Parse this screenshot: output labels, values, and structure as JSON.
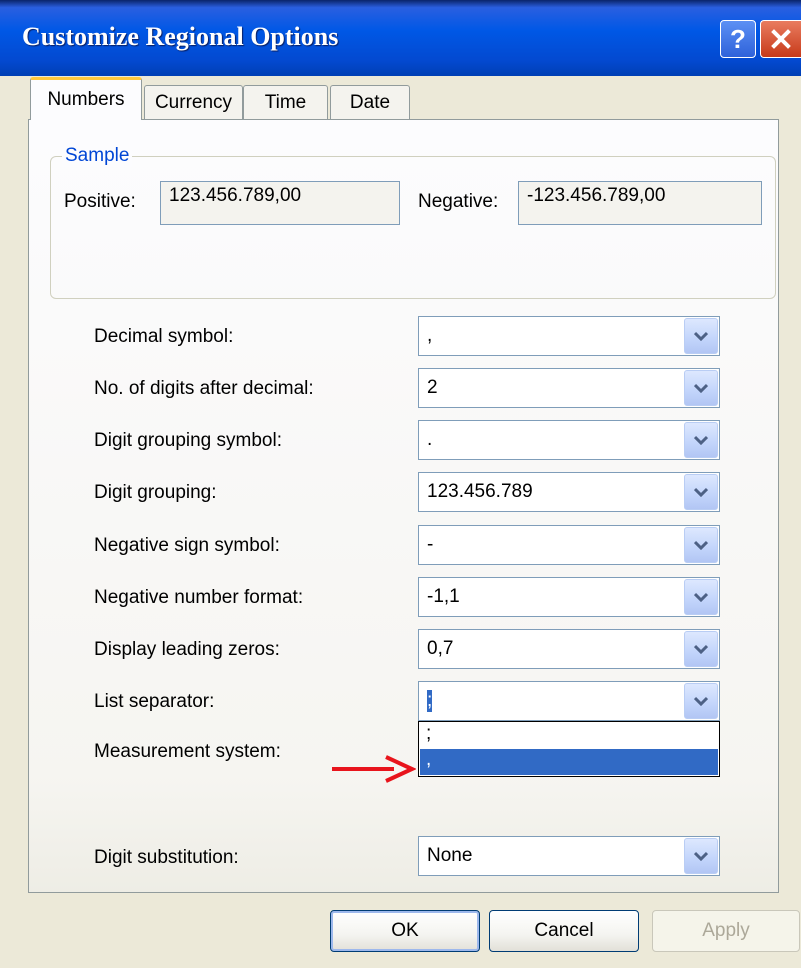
{
  "window": {
    "title": "Customize Regional Options",
    "help_glyph": "?",
    "close_icon": "close-icon"
  },
  "tabs": [
    {
      "label": "Numbers",
      "active": true
    },
    {
      "label": "Currency",
      "active": false
    },
    {
      "label": "Time",
      "active": false
    },
    {
      "label": "Date",
      "active": false
    }
  ],
  "sample": {
    "legend": "Sample",
    "positive_label": "Positive:",
    "positive_value": "123.456.789,00",
    "negative_label": "Negative:",
    "negative_value": "-123.456.789,00"
  },
  "settings": [
    {
      "label": "Decimal symbol:",
      "value": ","
    },
    {
      "label": "No. of digits after decimal:",
      "value": "2"
    },
    {
      "label": "Digit grouping symbol:",
      "value": "."
    },
    {
      "label": "Digit grouping:",
      "value": "123.456.789"
    },
    {
      "label": "Negative sign symbol:",
      "value": "-"
    },
    {
      "label": "Negative number format:",
      "value": "-1,1"
    },
    {
      "label": "Display leading zeros:",
      "value": "0,7"
    },
    {
      "label": "List separator:",
      "value": ";"
    },
    {
      "label": "Measurement system:"
    },
    {
      "label": "Digit substitution:",
      "value": "None"
    }
  ],
  "list_separator_dropdown": {
    "options": [
      ";",
      ","
    ],
    "highlighted": ","
  },
  "buttons": {
    "ok": "OK",
    "cancel": "Cancel",
    "apply": "Apply"
  },
  "colors": {
    "title_bar": "#0058E6",
    "selection": "#316AC5",
    "annotation_arrow": "#E8141C",
    "active_tab_accent": "#FFC83C"
  }
}
